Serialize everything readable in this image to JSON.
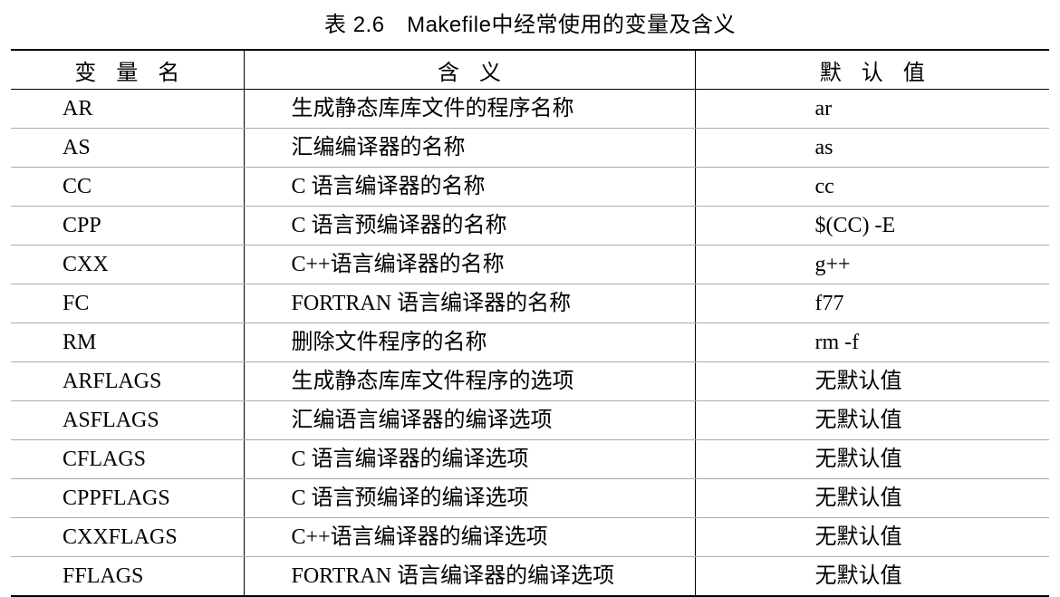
{
  "caption": "表 2.6　Makefile中经常使用的变量及含义",
  "headers": {
    "variable": "变量名",
    "meaning": "含义",
    "default": "默认值"
  },
  "rows": [
    {
      "variable": "AR",
      "meaning": "生成静态库库文件的程序名称",
      "default": "ar"
    },
    {
      "variable": "AS",
      "meaning": "汇编编译器的名称",
      "default": "as"
    },
    {
      "variable": "CC",
      "meaning": "C 语言编译器的名称",
      "default": "cc"
    },
    {
      "variable": "CPP",
      "meaning": "C 语言预编译器的名称",
      "default": "$(CC) -E"
    },
    {
      "variable": "CXX",
      "meaning": "C++语言编译器的名称",
      "default": "g++"
    },
    {
      "variable": "FC",
      "meaning": "FORTRAN 语言编译器的名称",
      "default": "f77"
    },
    {
      "variable": "RM",
      "meaning": "删除文件程序的名称",
      "default": "rm -f"
    },
    {
      "variable": "ARFLAGS",
      "meaning": "生成静态库库文件程序的选项",
      "default": "无默认值"
    },
    {
      "variable": "ASFLAGS",
      "meaning": "汇编语言编译器的编译选项",
      "default": "无默认值"
    },
    {
      "variable": "CFLAGS",
      "meaning": "C 语言编译器的编译选项",
      "default": "无默认值"
    },
    {
      "variable": "CPPFLAGS",
      "meaning": "C 语言预编译的编译选项",
      "default": "无默认值"
    },
    {
      "variable": "CXXFLAGS",
      "meaning": "C++语言编译器的编译选项",
      "default": "无默认值"
    },
    {
      "variable": "FFLAGS",
      "meaning": "FORTRAN 语言编译器的编译选项",
      "default": "无默认值"
    }
  ]
}
